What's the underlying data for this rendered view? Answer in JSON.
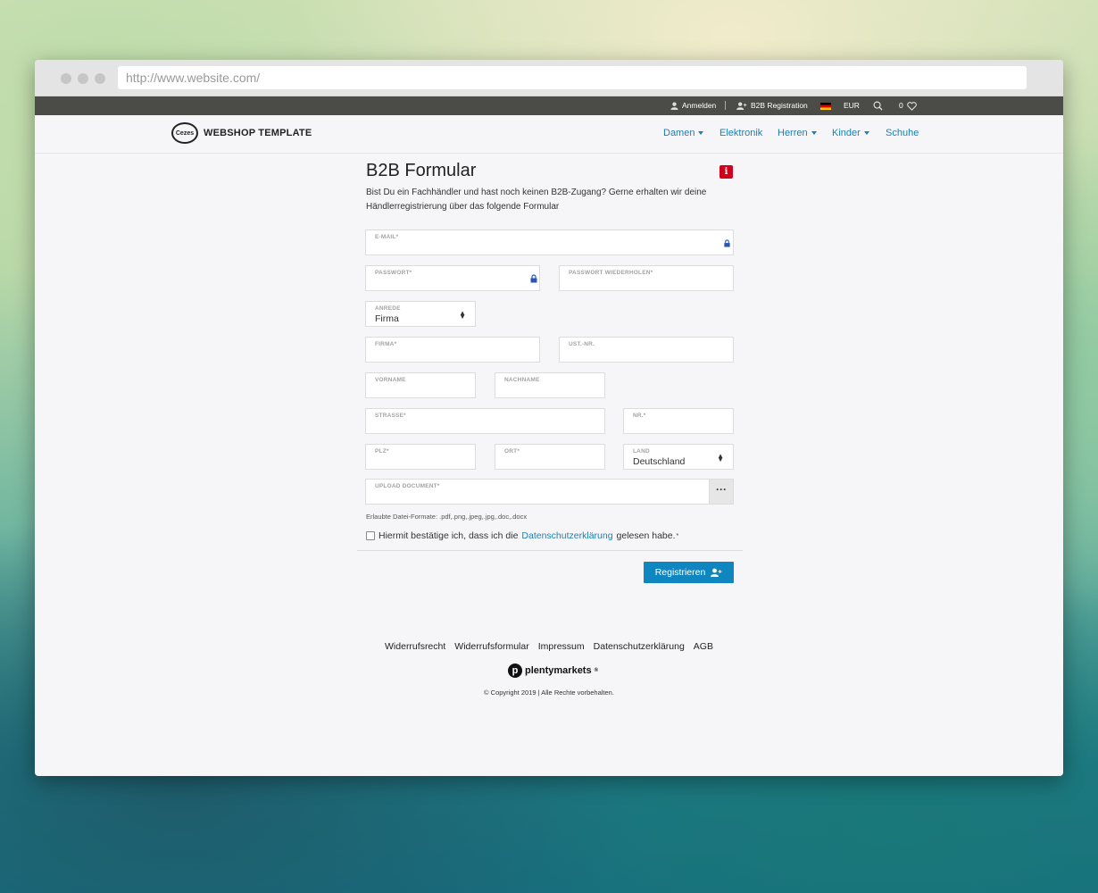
{
  "browser": {
    "url": "http://www.website.com/"
  },
  "topbar": {
    "login": "Anmelden",
    "b2b_registration": "B2B Registration",
    "currency": "EUR",
    "wishlist_count": "0",
    "icons": [
      "user-icon",
      "user-plus-icon",
      "german-flag-icon",
      "search-icon",
      "heart-icon"
    ]
  },
  "header": {
    "logo_mark": "Cezes",
    "logo_text": "WEBSHOP TEMPLATE",
    "nav": [
      {
        "label": "Damen",
        "dropdown": true
      },
      {
        "label": "Elektronik",
        "dropdown": false
      },
      {
        "label": "Herren",
        "dropdown": true
      },
      {
        "label": "Kinder",
        "dropdown": true
      },
      {
        "label": "Schuhe",
        "dropdown": false
      }
    ]
  },
  "form": {
    "title": "B2B Formular",
    "info_glyph": "i",
    "intro": "Bist Du ein Fachhändler und hast noch keinen B2B-Zugang? Gerne erhalten wir deine Händlerregistrierung über das folgende Formular",
    "fields": {
      "email": "E-MAIL*",
      "password": "PASSWORT*",
      "password_repeat": "PASSWORT WIEDERHOLEN*",
      "salutation": "ANREDE",
      "salutation_value": "Firma",
      "company": "FIRMA*",
      "vat": "UST.-NR.",
      "firstname": "VORNAME",
      "lastname": "NACHNAME",
      "street": "STRASSE*",
      "number": "NR.*",
      "zip": "PLZ*",
      "city": "ORT*",
      "country": "LAND",
      "country_value": "Deutschland",
      "upload": "UPLOAD DOCUMENT*",
      "upload_button": "···"
    },
    "allowed_formats": "Erlaubte Datei-Formate: .pdf,.png,.jpeg,.jpg,.doc,.docx",
    "privacy": {
      "prefix": "Hiermit bestätige ich, dass ich die",
      "link": "Datenschutzerklärung",
      "suffix": "gelesen habe.",
      "required_mark": "*"
    },
    "submit": "Registrieren"
  },
  "footer": {
    "links": [
      "Widerrufsrecht",
      "Widerrufsformular",
      "Impressum",
      "Datenschutzerklärung",
      "AGB"
    ],
    "brand_mark": "p",
    "brand": "plentymarkets",
    "brand_reg": "®",
    "copyright": "© Copyright 2019 | Alle Rechte vorbehalten."
  }
}
